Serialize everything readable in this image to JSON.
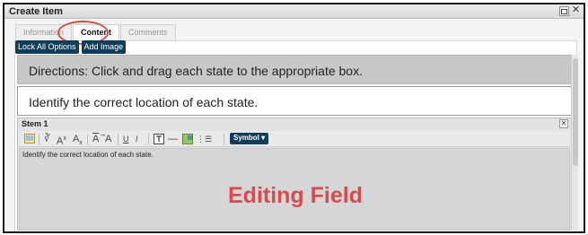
{
  "window": {
    "title": "Create Item"
  },
  "tabs": [
    {
      "label": "Information",
      "active": false
    },
    {
      "label": "Content",
      "active": true
    },
    {
      "label": "Comments",
      "active": false
    }
  ],
  "toolbar": {
    "lock_label": "Lock All Options",
    "add_image_label": "Add Image"
  },
  "directions": "Directions: Click and drag each state to the appropriate box.",
  "question": "Identify the correct location of each state.",
  "stem": {
    "title": "Stem 1",
    "symbol_button": "Symbol ▾",
    "content": "Identify the correct location of each state.",
    "annotation": "Editing Field"
  },
  "colors": {
    "button_bg": "#123d59",
    "annotation": "#d94a4f",
    "highlight_circle": "#dd4b4b"
  }
}
